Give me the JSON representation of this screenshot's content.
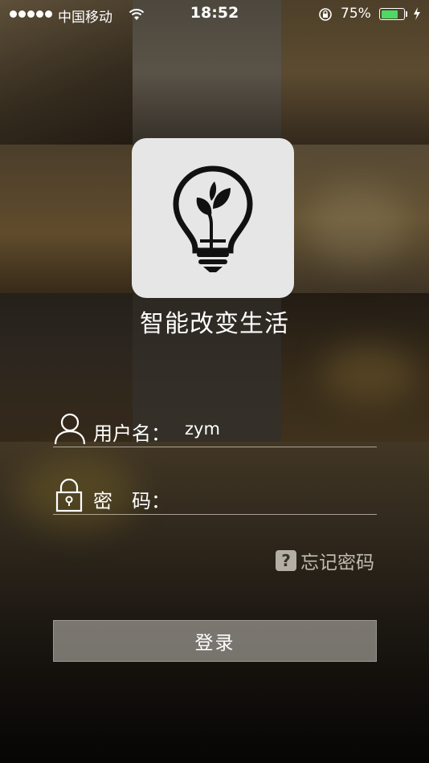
{
  "status_bar": {
    "carrier": "中国移动",
    "time": "18:52",
    "battery_percent": "75%",
    "battery_level": 0.75,
    "icons": [
      "signal-dots-icon",
      "wifi-icon",
      "rotation-lock-icon",
      "battery-icon",
      "charging-bolt-icon"
    ]
  },
  "app": {
    "logo_icon": "lightbulb-sprout-icon",
    "title": "智能改变生活"
  },
  "login_form": {
    "username_label": "用户名：",
    "username_value": "zym",
    "username_icon": "user-icon",
    "password_label": "密　码：",
    "password_value": "",
    "password_icon": "lock-icon",
    "forgot_password": "忘记密码",
    "forgot_icon": "question-icon",
    "login_button": "登录"
  },
  "colors": {
    "accent_battery": "#4cd964",
    "logo_background": "#e6e6e6",
    "button_background": "rgba(200,196,190,0.55)"
  }
}
